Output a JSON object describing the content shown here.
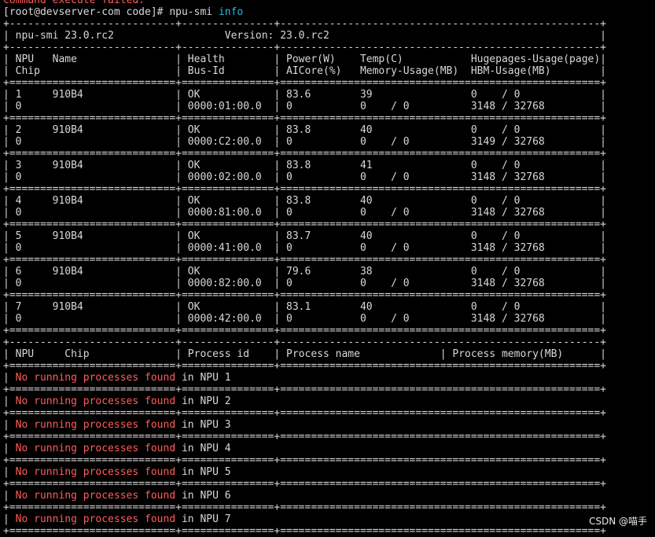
{
  "prev_output": {
    "text": "command execute failed.",
    "color": "#ff5c5c"
  },
  "prompt": {
    "text": "[root@devserver-com code]# ",
    "cmd": "npu-smi ",
    "arg": "info",
    "arg_color": "#29b8db"
  },
  "table": {
    "border_plus": "+===========================+===============+====================================================+",
    "border_dash": "+---------------------------+---------------+----------------------------------------------------+",
    "version_line": "| npu-smi 23.0.rc2                  Version: 23.0.rc2                                            |",
    "header_line1": "| NPU   Name                | Health        | Power(W)    Temp(C)           Hugepages-Usage(page)|",
    "header_line2": "| Chip                      | Bus-Id        | AICore(%)   Memory-Usage(MB)  HBM-Usage(MB)        |",
    "rows": [
      {
        "l1": "| 1     910B4               | OK            | 83.6        39                0    / 0             |",
        "l2": "| 0                         | 0000:01:00.0  | 0           0    / 0          3148 / 32768         |"
      },
      {
        "l1": "| 2     910B4               | OK            | 83.8        40                0    / 0             |",
        "l2": "| 0                         | 0000:C2:00.0  | 0           0    / 0          3149 / 32768         |"
      },
      {
        "l1": "| 3     910B4               | OK            | 83.8        41                0    / 0             |",
        "l2": "| 0                         | 0000:02:00.0  | 0           0    / 0          3148 / 32768         |"
      },
      {
        "l1": "| 4     910B4               | OK            | 83.8        40                0    / 0             |",
        "l2": "| 0                         | 0000:81:00.0  | 0           0    / 0          3148 / 32768         |"
      },
      {
        "l1": "| 5     910B4               | OK            | 83.7        40                0    / 0             |",
        "l2": "| 0                         | 0000:41:00.0  | 0           0    / 0          3148 / 32768         |"
      },
      {
        "l1": "| 6     910B4               | OK            | 79.6        38                0    / 0             |",
        "l2": "| 0                         | 0000:82:00.0  | 0           0    / 0          3148 / 32768         |"
      },
      {
        "l1": "| 7     910B4               | OK            | 83.1        40                0    / 0             |",
        "l2": "| 0                         | 0000:42:00.0  | 0           0    / 0          3148 / 32768         |"
      }
    ]
  },
  "process_table": {
    "border_plus": "+===========================+===============+====================================================+",
    "border_dash": "+---------------------------+---------------+----------------------------------------------------+",
    "header": "| NPU     Chip              | Process id    | Process name             | Process memory(MB)      |",
    "empty_row_tail": "                                                                          |",
    "rows": [
      {
        "msg": "No running processes found",
        "rest": " in NPU 1"
      },
      {
        "msg": "No running processes found",
        "rest": " in NPU 2"
      },
      {
        "msg": "No running processes found",
        "rest": " in NPU 3"
      },
      {
        "msg": "No running processes found",
        "rest": " in NPU 4"
      },
      {
        "msg": "No running processes found",
        "rest": " in NPU 5"
      },
      {
        "msg": "No running processes found",
        "rest": " in NPU 6"
      },
      {
        "msg": "No running processes found",
        "rest": " in NPU 7"
      }
    ],
    "msg_color": "#ff5c5c"
  },
  "watermark": "CSDN @喵手"
}
